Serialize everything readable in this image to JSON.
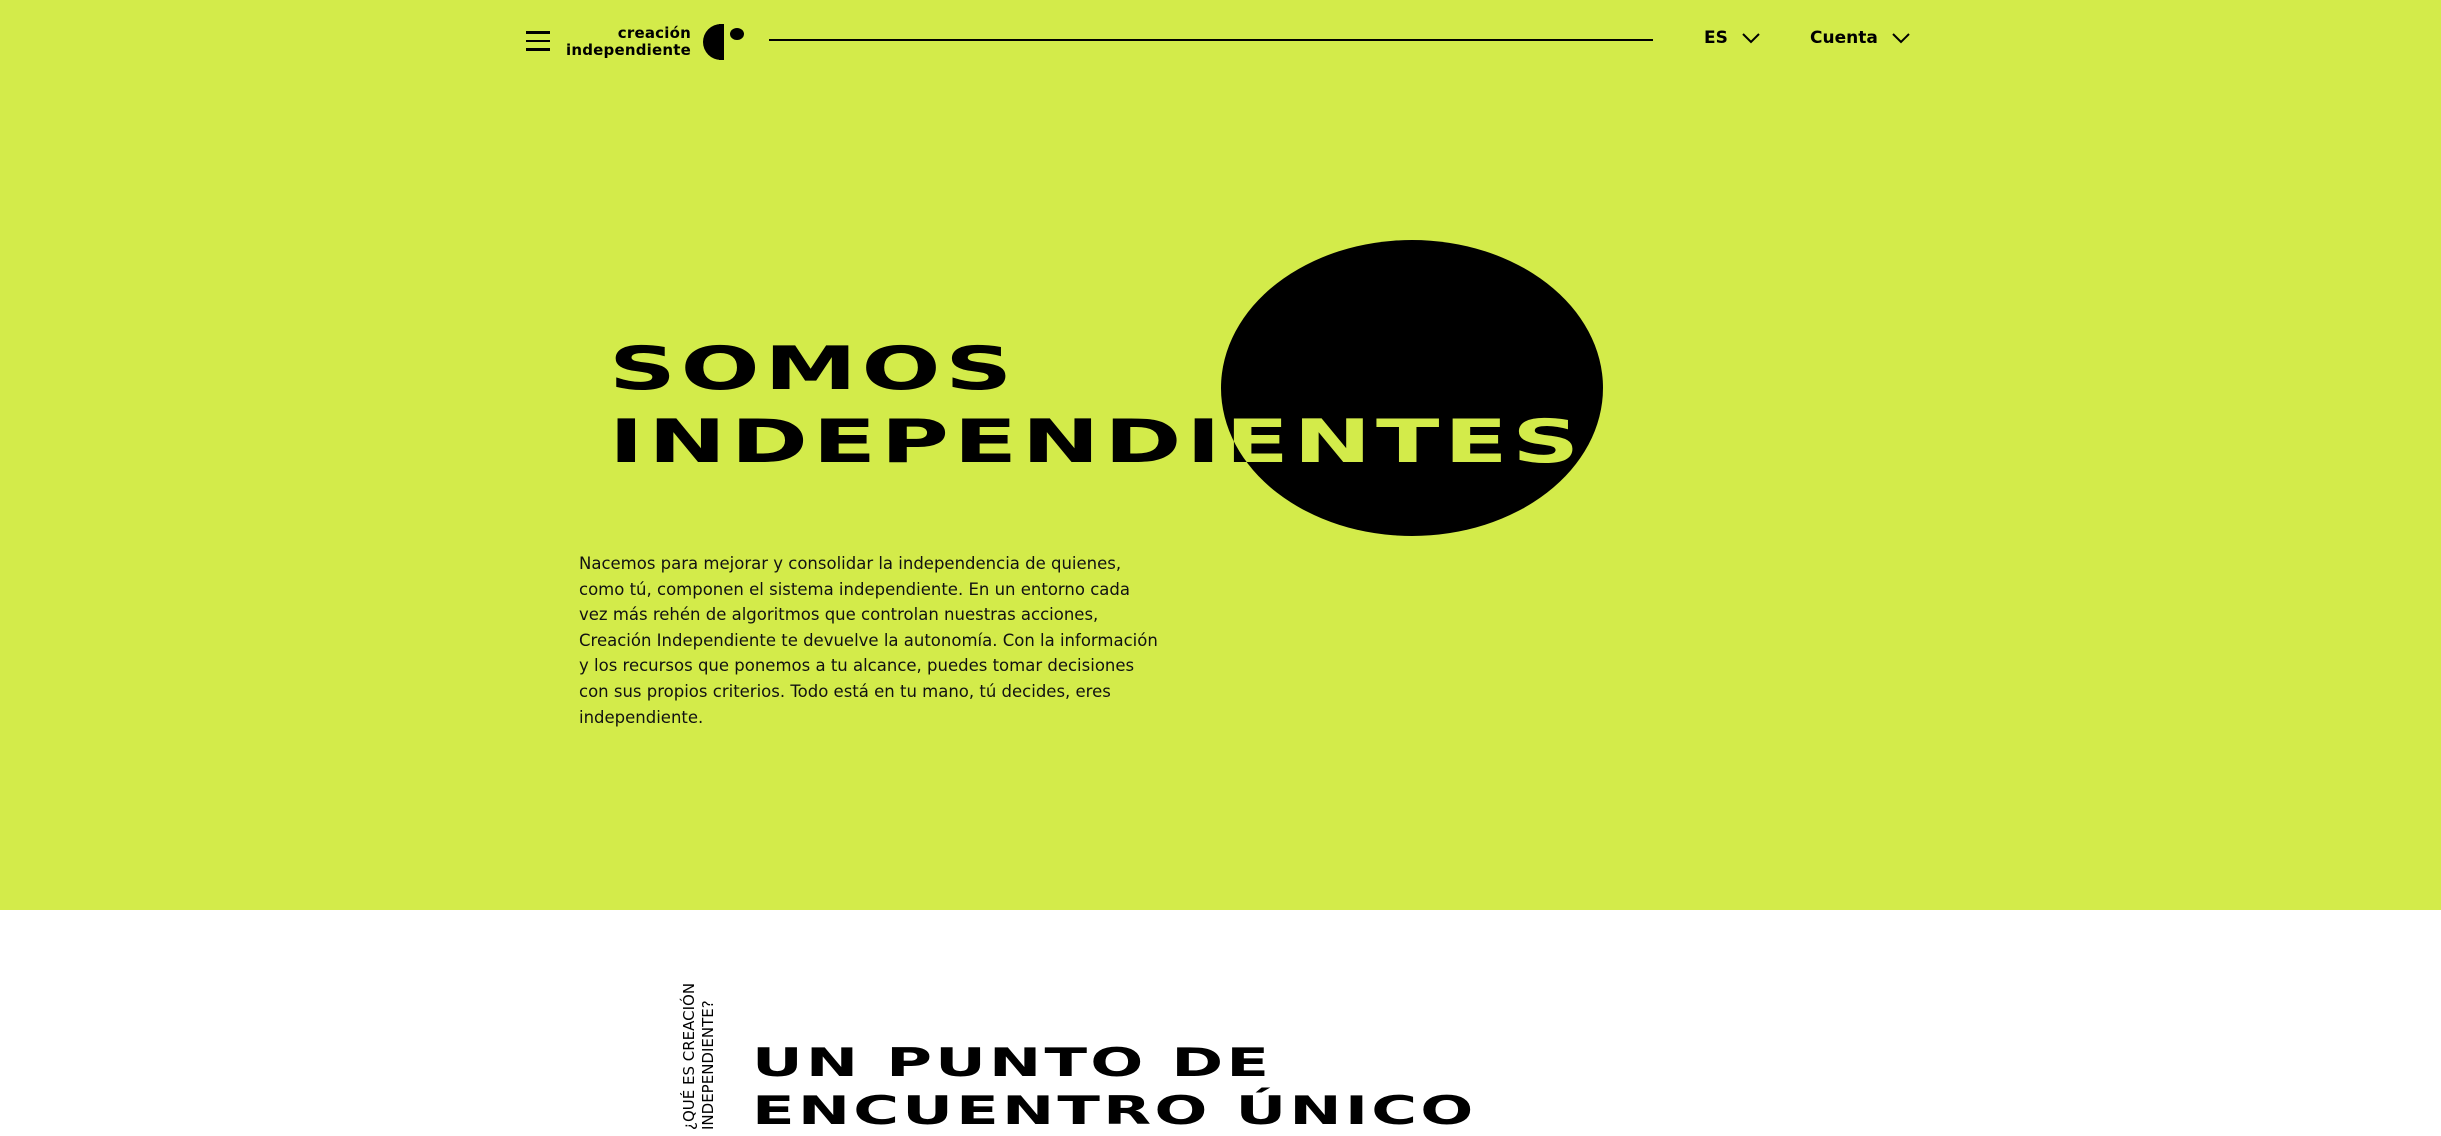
{
  "header": {
    "logo_line1": "creación",
    "logo_line2": "independiente",
    "language_label": "ES",
    "account_label": "Cuenta"
  },
  "hero": {
    "title_line1": "SOMOS",
    "title_line2": "INDEPENDIENTES",
    "paragraph": "Nacemos para mejorar y consolidar la independencia de quienes, como tú, componen el sistema independiente. En un entorno cada vez más rehén de algoritmos que controlan nuestras acciones, Creación Independiente te devuelve la autonomía. Con la información y los recursos que ponemos a tu alcance, puedes tomar decisiones con sus propios criterios. Todo está en tu mano, tú decides, eres independiente.",
    "background_color": "#d3eb4a",
    "blob_color": "#000000"
  },
  "section": {
    "vertical_line1": "¿QUÉ ES CREACIÓN",
    "vertical_line2": "INDEPENDIENTE?",
    "title_line1": "UN PUNTO DE",
    "title_line2": "ENCUENTRO ÚNICO"
  }
}
